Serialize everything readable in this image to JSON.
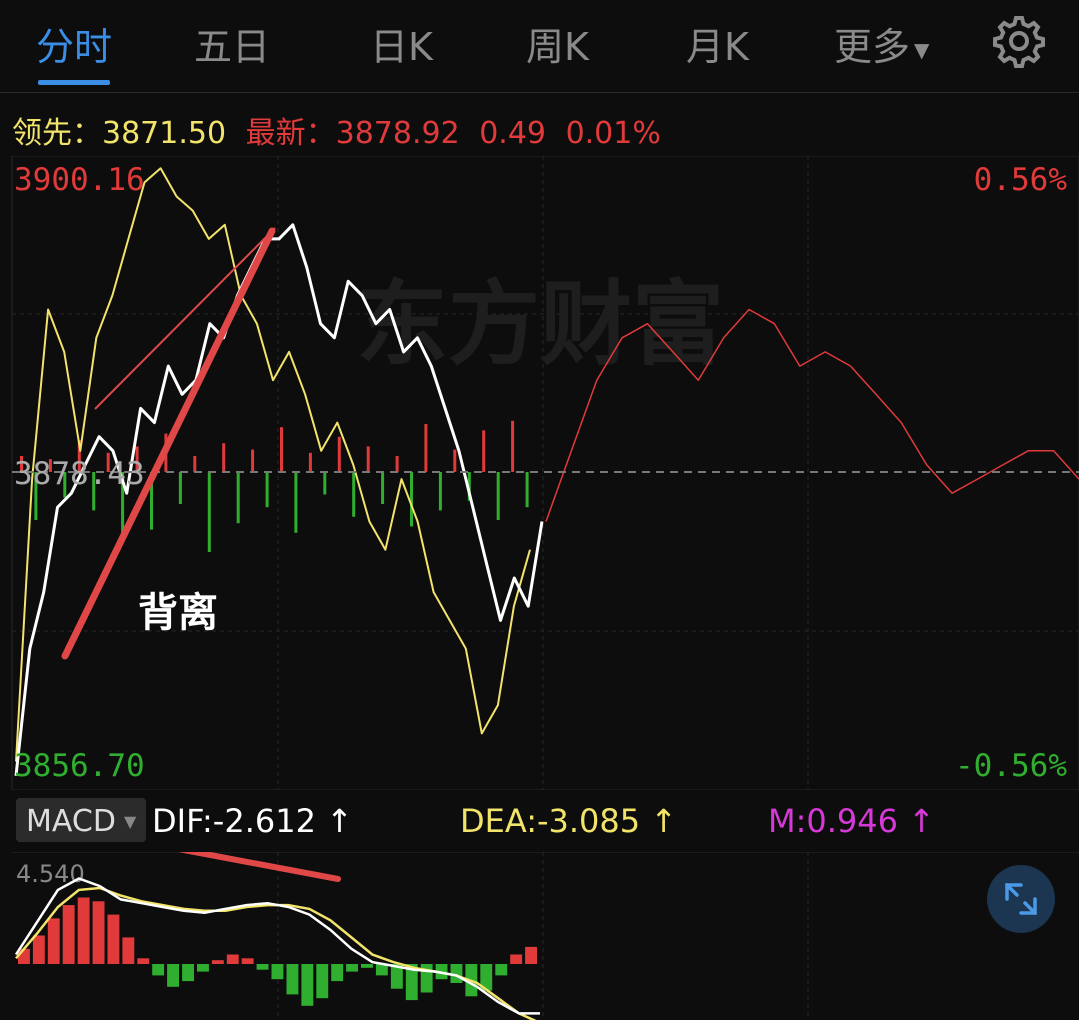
{
  "tabs": [
    {
      "label": "分时",
      "active": true
    },
    {
      "label": "五日",
      "active": false
    },
    {
      "label": "日K",
      "active": false
    },
    {
      "label": "周K",
      "active": false
    },
    {
      "label": "月K",
      "active": false
    },
    {
      "label": "更多",
      "active": false,
      "dropdown": true
    }
  ],
  "settings_icon": "gear-icon",
  "info": {
    "lead_label": "领先：",
    "lead_value": "3871.50",
    "latest_label": "最新：",
    "latest_value": "3878.92",
    "change": "0.49",
    "change_pct": "0.01%"
  },
  "price_axis": {
    "high": "3900.16",
    "mid": "3878.43",
    "low": "3856.70",
    "high_pct": "0.56%",
    "low_pct": "-0.56%"
  },
  "watermark": "东方财富",
  "annotation": "背离",
  "indicator": {
    "name": "MACD",
    "dif": "DIF:-2.612",
    "dea": "DEA:-3.085",
    "m": "M:0.946",
    "arrow": "↑",
    "scale_max": "4.540"
  },
  "colors": {
    "up": "#e03a3a",
    "down": "#2fae2f",
    "price_line": "#ffffff",
    "lead_line": "#f2e36a",
    "accent": "#3a8ee6",
    "m_color": "#d63ad6"
  },
  "expand_icon": "expand-icon",
  "chart_data": [
    {
      "type": "line",
      "title": "",
      "ylim": [
        3856.7,
        3900.16
      ],
      "series": [
        {
          "name": "价格",
          "values": [
            3857,
            3866,
            3870,
            3876,
            3877,
            3879,
            3881,
            3880,
            3877,
            3883,
            3882,
            3886,
            3884,
            3885,
            3889,
            3888,
            3891,
            3893,
            3895,
            3895,
            3896,
            3893,
            3889,
            3888,
            3892,
            3891,
            3889,
            3890,
            3887,
            3888,
            3886,
            3883,
            3880,
            3876,
            3872,
            3868,
            3871,
            3869,
            3875
          ]
        },
        {
          "name": "领先",
          "values": [
            3858,
            3878,
            3890,
            3887,
            3880,
            3888,
            3891,
            3895,
            3899,
            3900,
            3898,
            3897,
            3895,
            3896,
            3891,
            3889,
            3885,
            3887,
            3884,
            3880,
            3882,
            3879,
            3875,
            3873,
            3878,
            3875,
            3870,
            3868,
            3866,
            3860,
            3862,
            3869,
            3873
          ]
        },
        {
          "name": "",
          "values": [
            3875,
            3880,
            3885,
            3888,
            3889,
            3887,
            3885,
            3888,
            3890,
            3889,
            3886,
            3887,
            3886,
            3884,
            3882,
            3879,
            3877,
            3878,
            3879,
            3880,
            3880,
            3878
          ]
        }
      ]
    },
    {
      "type": "bar",
      "title": "",
      "values": [
        0.5,
        -1.5,
        0.4,
        -0.8,
        1.0,
        -1.2,
        0.6,
        -2.0,
        0.8,
        -1.8,
        1.2,
        -1.0,
        0.5,
        -2.5,
        0.9,
        -1.6,
        0.7,
        -1.1,
        1.4,
        -1.9,
        0.6,
        -0.7,
        1.1,
        -1.4,
        0.8,
        -1.0,
        0.5,
        -1.7,
        1.5,
        -1.2,
        0.7,
        -0.9,
        1.3,
        -1.5,
        1.6,
        -1.1
      ]
    },
    {
      "type": "bar",
      "title": "MACD",
      "values": [
        0.8,
        1.5,
        2.4,
        3.1,
        3.5,
        3.3,
        2.6,
        1.4,
        0.3,
        -0.6,
        -1.2,
        -0.9,
        -0.4,
        0.2,
        0.5,
        0.3,
        -0.3,
        -0.8,
        -1.6,
        -2.2,
        -1.8,
        -0.9,
        -0.4,
        -0.2,
        -0.6,
        -1.3,
        -1.9,
        -1.5,
        -0.8,
        -1.0,
        -1.7,
        -1.4,
        -0.6,
        0.5,
        0.9
      ],
      "series": [
        {
          "name": "DIF",
          "values": [
            0.5,
            2.2,
            3.9,
            4.5,
            4.1,
            3.4,
            3.2,
            3.0,
            2.8,
            2.7,
            2.9,
            3.1,
            3.2,
            3.0,
            2.6,
            1.8,
            0.8,
            0.1,
            -0.1,
            -0.3,
            -0.4,
            -0.6,
            -1.2,
            -2.0,
            -2.6,
            -2.6
          ]
        },
        {
          "name": "DEA",
          "values": [
            0.3,
            1.6,
            3.0,
            3.9,
            4.0,
            3.6,
            3.3,
            3.1,
            2.9,
            2.8,
            2.8,
            3.0,
            3.1,
            3.1,
            2.9,
            2.3,
            1.4,
            0.5,
            0.1,
            -0.2,
            -0.4,
            -0.6,
            -1.0,
            -1.8,
            -2.6,
            -3.1
          ]
        }
      ]
    }
  ]
}
